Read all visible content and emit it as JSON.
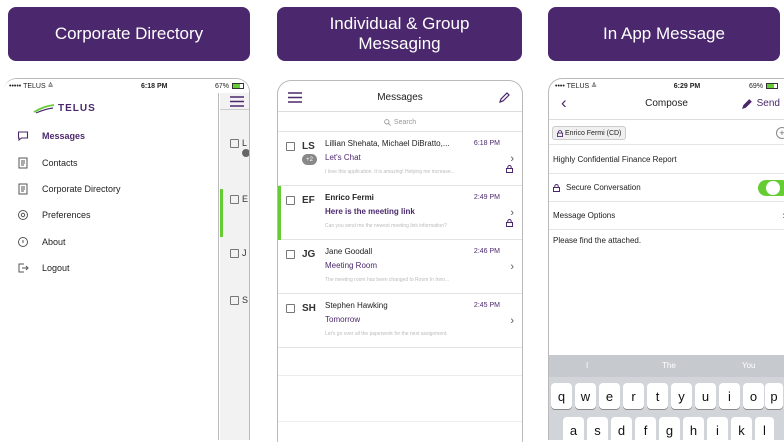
{
  "panel1": {
    "banner": "Corporate Directory",
    "status": {
      "carrier": "••••• TELUS ≙",
      "time": "6:18 PM",
      "battery": "67%"
    },
    "logo": "TELUS",
    "menu": [
      {
        "label": "Messages",
        "icon": "chat-bubble-icon"
      },
      {
        "label": "Contacts",
        "icon": "address-book-icon"
      },
      {
        "label": "Corporate Directory",
        "icon": "directory-book-icon"
      },
      {
        "label": "Preferences",
        "icon": "gear-icon"
      },
      {
        "label": "About",
        "icon": "info-bubble-icon"
      },
      {
        "label": "Logout",
        "icon": "logout-icon"
      }
    ],
    "peek_initials": [
      "L",
      "E",
      "J",
      "S"
    ]
  },
  "panel2": {
    "banner_line1": "Individual & Group",
    "banner_line2": "Messaging",
    "title": "Messages",
    "search_placeholder": "Search",
    "messages": [
      {
        "initials": "LS",
        "badge": "+2",
        "name": "Lillian Shehata, Michael DiBratto,...",
        "time": "6:18 PM",
        "subject": "Let's Chat",
        "preview": "I love this application. It is amazing! Helping me increase...",
        "bold": false,
        "locked": true
      },
      {
        "initials": "EF",
        "badge": "",
        "name": "Enrico Fermi",
        "time": "2:49 PM",
        "subject": "Here is the meeting link",
        "preview": "Can you send me the newest meeting link information?",
        "bold": true,
        "locked": true
      },
      {
        "initials": "JG",
        "badge": "",
        "name": "Jane Goodall",
        "time": "2:46 PM",
        "subject": "Meeting Room",
        "preview": "The meeting room has been changed to Room In Inno...",
        "bold": false,
        "locked": false
      },
      {
        "initials": "SH",
        "badge": "",
        "name": "Stephen Hawking",
        "time": "2:45 PM",
        "subject": "Tomorrow",
        "preview": "Let's go over all the paperwork for the next assignment.",
        "bold": false,
        "locked": false
      }
    ]
  },
  "panel3": {
    "banner": "In App Message",
    "status": {
      "carrier": "•••• TELUS ≙",
      "time": "6:29 PM",
      "battery": "69%"
    },
    "title": "Compose",
    "send_label": "Send",
    "recipient": "Enrico Fermi (CD)",
    "subject": "Highly Confidential Finance Report",
    "secure_label": "Secure Conversation",
    "options_label": "Message Options",
    "body": "Please find the attached.",
    "suggestions": [
      "I",
      "The",
      "You"
    ],
    "row1": [
      "q",
      "w",
      "e",
      "r",
      "t",
      "y",
      "u",
      "i",
      "o",
      "p"
    ],
    "row2": [
      "a",
      "s",
      "d",
      "f",
      "g",
      "h",
      "i",
      "k",
      "l"
    ]
  },
  "colors": {
    "brand": "#4b286d",
    "accent_green": "#66cc33"
  }
}
